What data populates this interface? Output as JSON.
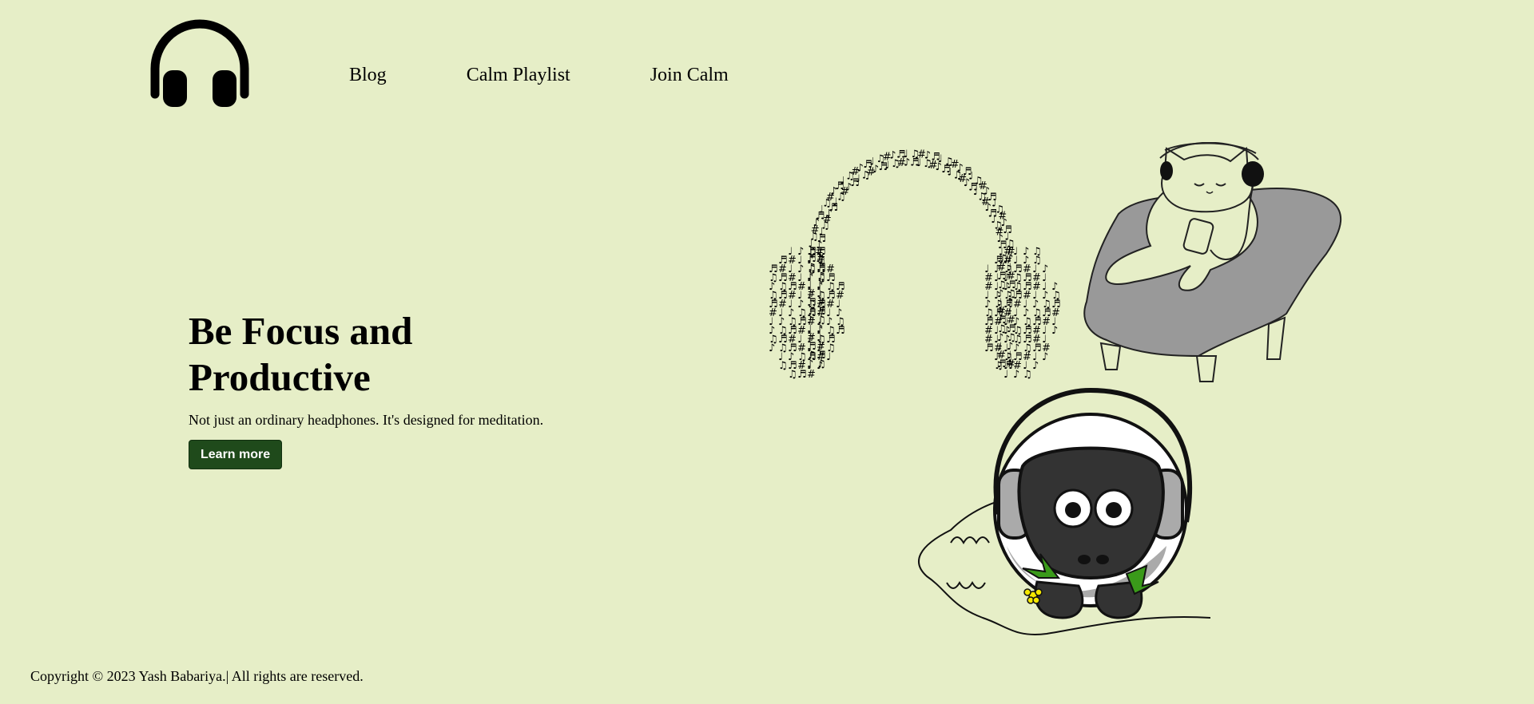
{
  "header": {
    "logo_icon": "headphones-icon",
    "nav": [
      {
        "label": "Blog"
      },
      {
        "label": "Calm Playlist"
      },
      {
        "label": "Join Calm"
      }
    ]
  },
  "hero": {
    "title": "Be Focus and Productive",
    "subtitle": "Not just an ordinary headphones. It's designed for meditation.",
    "cta_label": "Learn more"
  },
  "illustrations": {
    "music_notes_headphones": "music-notes-headphones-illustration",
    "cat": "cat-with-headphones-illustration",
    "sheep": "sheep-with-headphones-illustration"
  },
  "colors": {
    "background": "#e6eec7",
    "button": "#1f4a1b",
    "button_text": "#ffffff",
    "chair": "#999999",
    "sheep_face": "#333333"
  },
  "footer": {
    "copyright": "Copyright © 2023 Yash Babariya.| All rights are reserved."
  }
}
